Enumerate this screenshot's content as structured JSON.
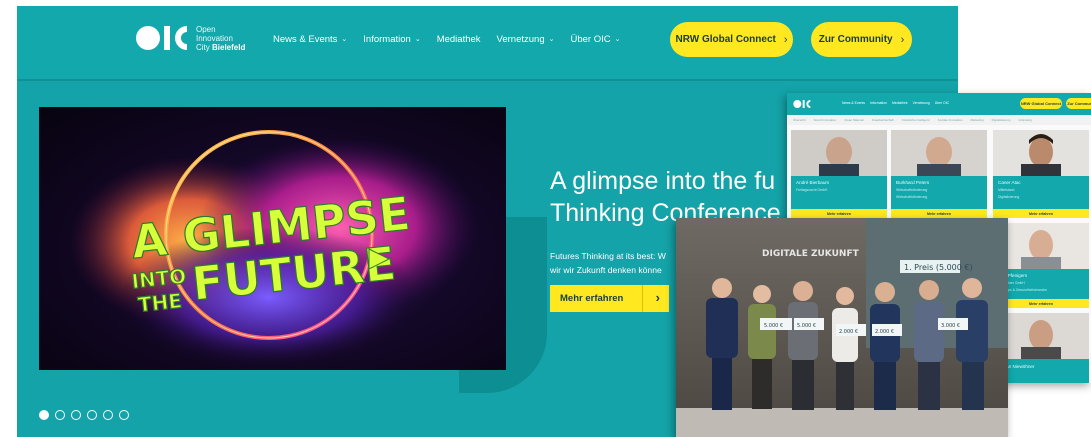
{
  "logo": {
    "line1": "Open",
    "line2": "Innovation",
    "line3_prefix": "City ",
    "line3_bold": "Bielefeld"
  },
  "nav": [
    {
      "label": "News & Events",
      "chevron": "⌄"
    },
    {
      "label": "Information",
      "chevron": "⌄"
    },
    {
      "label": "Mediathek",
      "chevron": ""
    },
    {
      "label": "Vernetzung",
      "chevron": "⌄"
    },
    {
      "label": "Über OIC",
      "chevron": "⌄"
    }
  ],
  "header_buttons": {
    "primary": "NRW Global Connect",
    "secondary": "Zur Community",
    "arrow": "›"
  },
  "hero": {
    "artwork_word1": "A GLIMPSE",
    "artwork_word2": "INTO",
    "artwork_word3": "THE",
    "artwork_word4": "FUTURE",
    "headline_line1": "A glimpse into the fu",
    "headline_line2": "Thinking Conference",
    "sub_line1": "Futures Thinking at its best: W",
    "sub_line2": "wir wir Zukunft denken könne",
    "cta_label": "Mehr erfahren",
    "cta_arrow": "›"
  },
  "carousel": {
    "slides": 6,
    "active_index": 0
  },
  "people_screenshot": {
    "buttons": [
      "NRW Global Connect",
      "Zur Community"
    ],
    "nav": [
      "News & Events",
      "Information",
      "Mediathek",
      "Vernetzung",
      "Über OIC"
    ],
    "subnav": [
      "Übersicht",
      "Smart Innovation",
      "Clean Material",
      "Kreativwirtschaft",
      "Künstliche Intelligenz",
      "Soziale Innovation",
      "Marketing",
      "Digitalisierung",
      "Gründung"
    ],
    "cards": [
      {
        "name": "André Bierbaum",
        "line1": "Freitagsnacht GmbH",
        "button": "Mehr erfahren"
      },
      {
        "name": "Burkhard Peters",
        "line1": "Wirtschaftsförderung",
        "line2": "Wirtschaftsförderung",
        "button": "Mehr erfahren"
      },
      {
        "name": "Caner Atac",
        "line1": "Mittelstand",
        "line2": "Digitalisierung",
        "button": "Mehr erfahren"
      },
      {
        "name": "Lisa Pfenigers",
        "line1": "Bielefelder GmbH",
        "line2": "Start-ups & Gesundheitsbranche",
        "button": "Mehr erfahren"
      },
      {
        "name": "Stefan Niewöhner",
        "line1": "",
        "button": ""
      }
    ]
  },
  "event_photo": {
    "backdrop": "DIGITALE ZUKUNFT",
    "sign": "1. Preis (5.000 €)",
    "cheques": [
      "5.000 €",
      "5.000 €",
      "2.000 €",
      "2.000 €",
      "3.000 €"
    ]
  }
}
